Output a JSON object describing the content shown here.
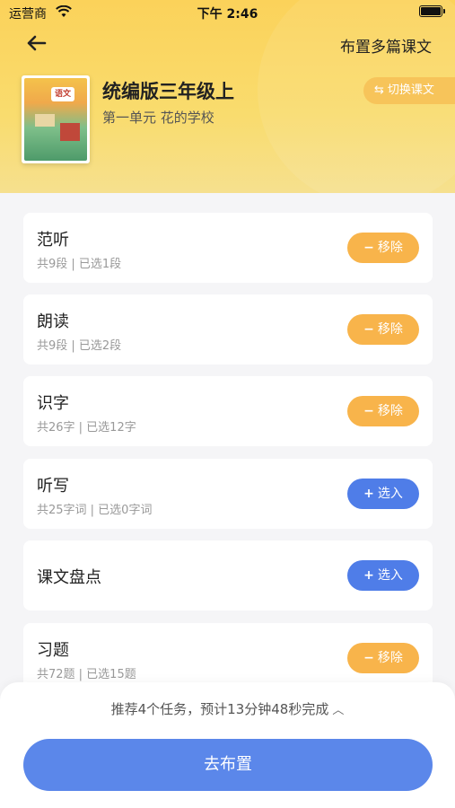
{
  "status_bar": {
    "carrier": "运营商",
    "time": "下午 2:46"
  },
  "nav": {
    "action": "布置多篇课文"
  },
  "book": {
    "cover_badge": "语文",
    "title": "统编版三年级上",
    "unit": "第一单元 花的学校",
    "switch_label": "切换课文"
  },
  "tasks": [
    {
      "title": "范听",
      "subtitle": "共9段 | 已选1段",
      "action_symbol": "−",
      "action_label": "移除"
    },
    {
      "title": "朗读",
      "subtitle": "共9段 | 已选2段",
      "action_symbol": "−",
      "action_label": "移除"
    },
    {
      "title": "识字",
      "subtitle": "共26字 | 已选12字",
      "action_symbol": "−",
      "action_label": "移除"
    },
    {
      "title": "听写",
      "subtitle": "共25字词 | 已选0字词",
      "action_symbol": "+",
      "action_label": "选入"
    },
    {
      "title": "课文盘点",
      "subtitle": "",
      "action_symbol": "+",
      "action_label": "选入"
    },
    {
      "title": "习题",
      "subtitle": "共72题 | 已选15题",
      "action_symbol": "−",
      "action_label": "移除"
    }
  ],
  "bottom": {
    "summary": "推荐4个任务，预计13分钟48秒完成",
    "button": "去布置"
  },
  "colors": {
    "remove": "#f8b44b",
    "add": "#4f7de8",
    "primary": "#5b87ea",
    "header": "#fbd25a"
  }
}
